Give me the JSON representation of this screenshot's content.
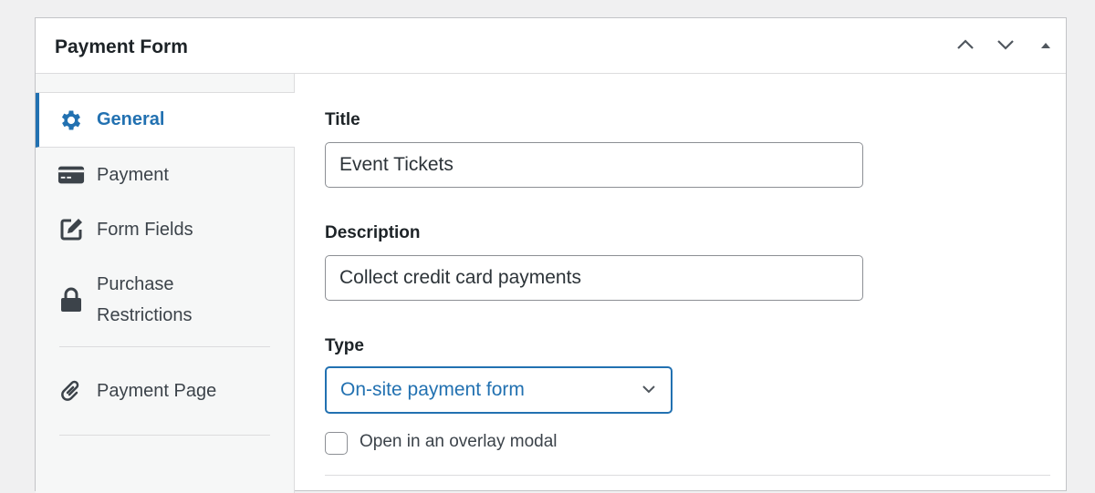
{
  "panel": {
    "title": "Payment Form",
    "controls": [
      "move-up",
      "move-down",
      "toggle-panel"
    ]
  },
  "sidebar": {
    "items": [
      {
        "label": "General",
        "icon": "gear-icon",
        "active": true
      },
      {
        "label": "Payment",
        "icon": "credit-card-icon"
      },
      {
        "label": "Form Fields",
        "icon": "edit-icon"
      },
      {
        "label": "Purchase Restrictions",
        "icon": "lock-icon"
      },
      {
        "label": "Payment Page",
        "icon": "link-icon"
      }
    ]
  },
  "form": {
    "title_label": "Title",
    "title_value": "Event Tickets",
    "description_label": "Description",
    "description_value": "Collect credit card payments",
    "type_label": "Type",
    "type_value": "On-site payment form",
    "overlay_label": "Open in an overlay modal",
    "overlay_checked": false
  },
  "colors": {
    "accent": "#2271b1"
  }
}
